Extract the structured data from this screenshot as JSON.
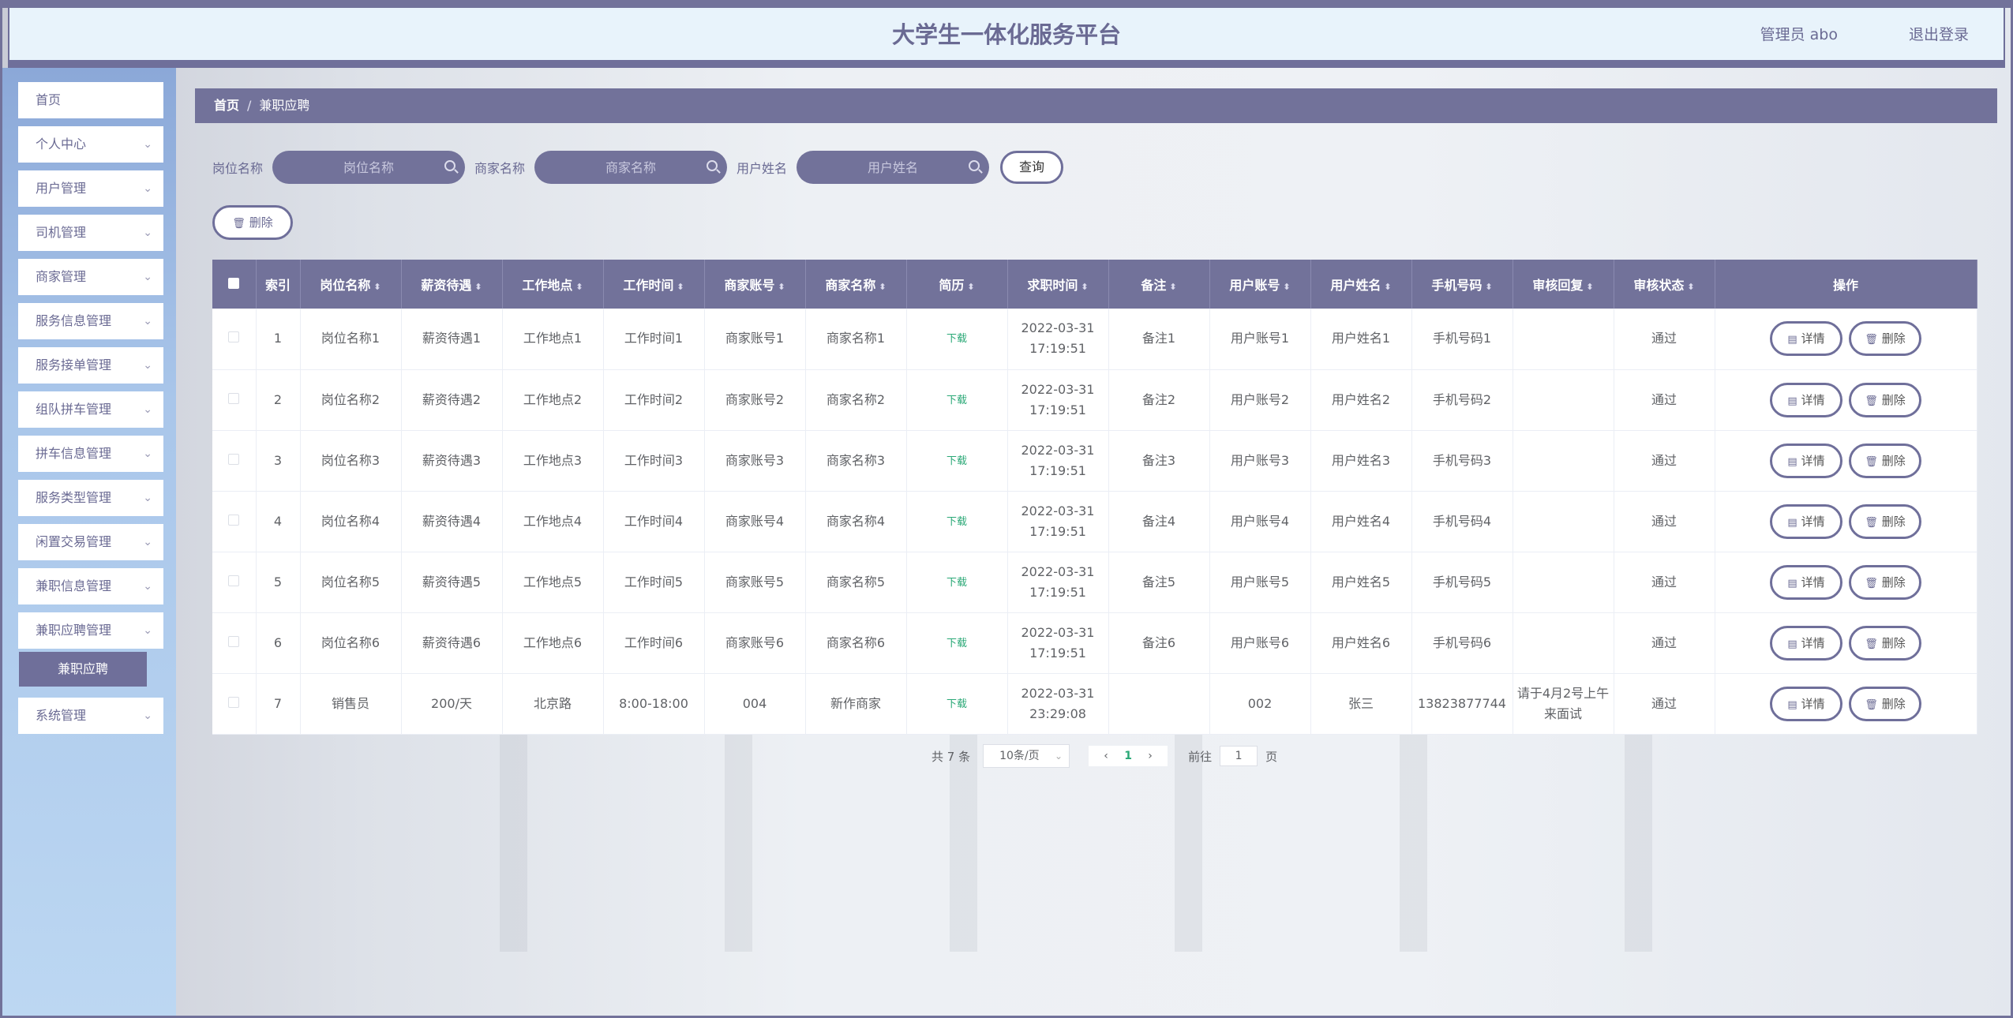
{
  "header": {
    "title": "大学生一体化服务平台",
    "user": "管理员 abo",
    "logout": "退出登录"
  },
  "sidebar": {
    "items": [
      {
        "label": "首页",
        "expandable": false
      },
      {
        "label": "个人中心",
        "expandable": true
      },
      {
        "label": "用户管理",
        "expandable": true
      },
      {
        "label": "司机管理",
        "expandable": true
      },
      {
        "label": "商家管理",
        "expandable": true
      },
      {
        "label": "服务信息管理",
        "expandable": true
      },
      {
        "label": "服务接单管理",
        "expandable": true
      },
      {
        "label": "组队拼车管理",
        "expandable": true
      },
      {
        "label": "拼车信息管理",
        "expandable": true
      },
      {
        "label": "服务类型管理",
        "expandable": true
      },
      {
        "label": "闲置交易管理",
        "expandable": true
      },
      {
        "label": "兼职信息管理",
        "expandable": true
      },
      {
        "label": "兼职应聘管理",
        "expandable": true
      },
      {
        "label": "系统管理",
        "expandable": true
      }
    ],
    "active_sub": "兼职应聘"
  },
  "breadcrumb": {
    "home": "首页",
    "sep": "/",
    "current": "兼职应聘"
  },
  "search": {
    "fields": [
      {
        "label": "岗位名称",
        "placeholder": "岗位名称"
      },
      {
        "label": "商家名称",
        "placeholder": "商家名称"
      },
      {
        "label": "用户姓名",
        "placeholder": "用户姓名"
      }
    ],
    "query_button": "查询"
  },
  "toolbar": {
    "delete_button": "删除"
  },
  "table": {
    "columns": [
      "索引",
      "岗位名称",
      "薪资待遇",
      "工作地点",
      "工作时间",
      "商家账号",
      "商家名称",
      "简历",
      "求职时间",
      "备注",
      "用户账号",
      "用户姓名",
      "手机号码",
      "审核回复",
      "审核状态",
      "操作"
    ],
    "sortable": [
      false,
      true,
      true,
      true,
      true,
      true,
      true,
      true,
      true,
      true,
      true,
      true,
      true,
      true,
      true,
      false
    ],
    "rows": [
      [
        "1",
        "岗位名称1",
        "薪资待遇1",
        "工作地点1",
        "工作时间1",
        "商家账号1",
        "商家名称1",
        "下载",
        "2022-03-31 17:19:51",
        "备注1",
        "用户账号1",
        "用户姓名1",
        "手机号码1",
        "",
        "通过"
      ],
      [
        "2",
        "岗位名称2",
        "薪资待遇2",
        "工作地点2",
        "工作时间2",
        "商家账号2",
        "商家名称2",
        "下载",
        "2022-03-31 17:19:51",
        "备注2",
        "用户账号2",
        "用户姓名2",
        "手机号码2",
        "",
        "通过"
      ],
      [
        "3",
        "岗位名称3",
        "薪资待遇3",
        "工作地点3",
        "工作时间3",
        "商家账号3",
        "商家名称3",
        "下载",
        "2022-03-31 17:19:51",
        "备注3",
        "用户账号3",
        "用户姓名3",
        "手机号码3",
        "",
        "通过"
      ],
      [
        "4",
        "岗位名称4",
        "薪资待遇4",
        "工作地点4",
        "工作时间4",
        "商家账号4",
        "商家名称4",
        "下载",
        "2022-03-31 17:19:51",
        "备注4",
        "用户账号4",
        "用户姓名4",
        "手机号码4",
        "",
        "通过"
      ],
      [
        "5",
        "岗位名称5",
        "薪资待遇5",
        "工作地点5",
        "工作时间5",
        "商家账号5",
        "商家名称5",
        "下载",
        "2022-03-31 17:19:51",
        "备注5",
        "用户账号5",
        "用户姓名5",
        "手机号码5",
        "",
        "通过"
      ],
      [
        "6",
        "岗位名称6",
        "薪资待遇6",
        "工作地点6",
        "工作时间6",
        "商家账号6",
        "商家名称6",
        "下载",
        "2022-03-31 17:19:51",
        "备注6",
        "用户账号6",
        "用户姓名6",
        "手机号码6",
        "",
        "通过"
      ],
      [
        "7",
        "销售员",
        "200/天",
        "北京路",
        "8:00-18:00",
        "004",
        "新作商家",
        "下载",
        "2022-03-31 23:29:08",
        "",
        "002",
        "张三",
        "13823877744",
        "请于4月2号上午来面试",
        "通过"
      ]
    ],
    "actions": {
      "detail": "详情",
      "delete": "删除"
    }
  },
  "pagination": {
    "total": "共 7 条",
    "page_size": "10条/页",
    "current": "1",
    "goto_label": "前往",
    "goto_value": "1",
    "page_suffix": "页"
  },
  "colors": {
    "primary": "#72729a",
    "link": "#2aa876",
    "header_bg": "#e8f3fb"
  },
  "icons": {
    "search": "search-icon",
    "delete": "trash-icon",
    "detail": "document-icon",
    "chevron": "chevron-down-icon"
  }
}
